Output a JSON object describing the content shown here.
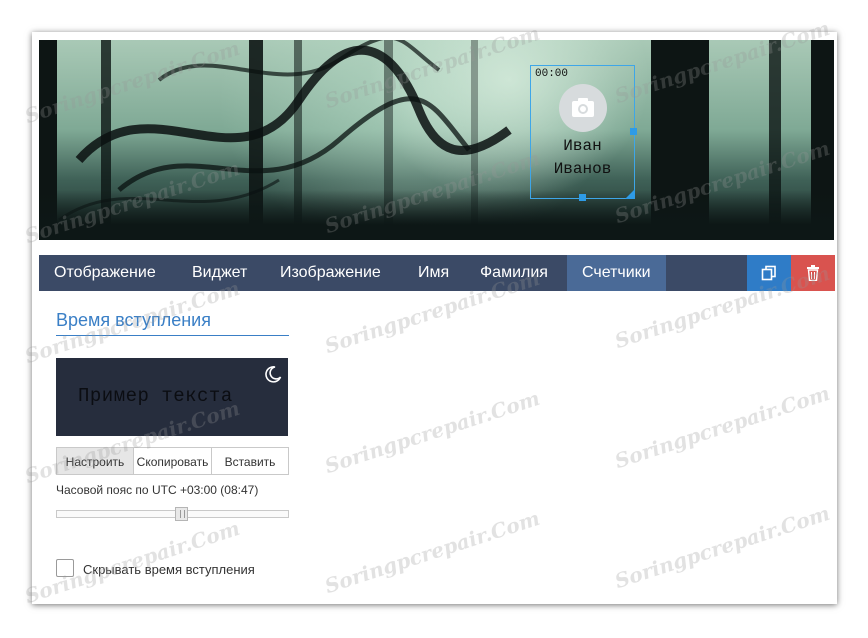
{
  "cover": {
    "widget": {
      "time": "00:00",
      "first_name": "Иван",
      "last_name": "Иванов",
      "avatar_icon": "camera-icon"
    }
  },
  "tabs": [
    {
      "label": "Отображение",
      "active": false
    },
    {
      "label": "Виджет",
      "active": false
    },
    {
      "label": "Изображение",
      "active": false
    },
    {
      "label": "Имя",
      "active": false
    },
    {
      "label": "Фамилия",
      "active": false
    },
    {
      "label": "Счетчики",
      "active": true
    }
  ],
  "toolbar": {
    "copy_icon": "copy-icon",
    "delete_icon": "trash-icon",
    "copy_color": "#2f7cc7",
    "delete_color": "#d9534f"
  },
  "panel": {
    "section_title": "Время вступления",
    "preview_text": "Пример текста",
    "theme_icon": "moon-icon",
    "buttons": {
      "configure": "Настроить",
      "copy": "Скопировать",
      "paste": "Вставить"
    },
    "timezone_label": "Часовой пояс по UTC +03:00 (08:47)",
    "timezone_slider_value": 0.56,
    "hide_checkbox_label": "Скрывать время вступления",
    "hide_checkbox_checked": false
  },
  "watermark": "Soringpcrepair.Com",
  "colors": {
    "tab_bar": "#3b4a66",
    "tab_active": "#4a6a97",
    "accent": "#3a7fc6",
    "selection": "#2e9be6"
  }
}
